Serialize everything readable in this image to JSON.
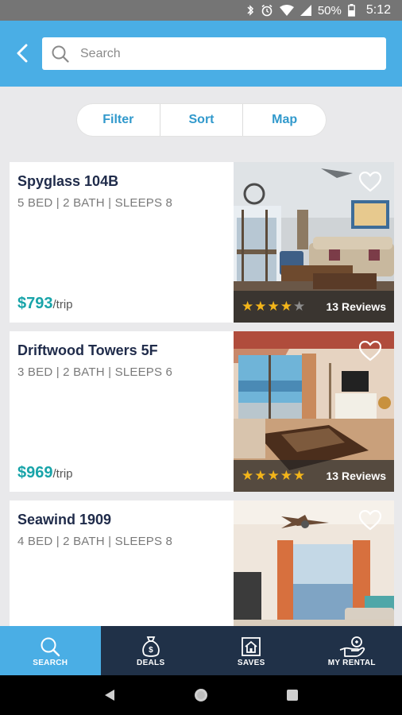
{
  "status_bar": {
    "battery_percent": "50%",
    "time": "5:12"
  },
  "search": {
    "placeholder": "Search"
  },
  "toolbar": {
    "filter_label": "Filter",
    "sort_label": "Sort",
    "map_label": "Map"
  },
  "listings": [
    {
      "name": "Spyglass 104B",
      "specs": "5 BED | 2 BATH | SLEEPS 8",
      "price": "$793",
      "price_unit": "/trip",
      "rating": 4,
      "reviews": "13 Reviews"
    },
    {
      "name": "Driftwood Towers 5F",
      "specs": "3 BED | 2 BATH | SLEEPS 6",
      "price": "$969",
      "price_unit": "/trip",
      "rating": 5,
      "reviews": "13 Reviews"
    },
    {
      "name": "Seawind 1909",
      "specs": "4 BED | 2 BATH | SLEEPS 8"
    }
  ],
  "bottom_nav": [
    {
      "label": "SEARCH",
      "icon": "search-icon",
      "active": true
    },
    {
      "label": "DEALS",
      "icon": "money-bag-icon",
      "active": false
    },
    {
      "label": "SAVES",
      "icon": "saved-house-icon",
      "active": false
    },
    {
      "label": "MY RENTAL",
      "icon": "hand-key-icon",
      "active": false
    }
  ],
  "colors": {
    "accent": "#4aaee5",
    "price": "#18a4a9",
    "nav_bg": "#203148",
    "title": "#1f2b4a",
    "segment_text": "#3199cc",
    "star": "#f3b51a"
  }
}
